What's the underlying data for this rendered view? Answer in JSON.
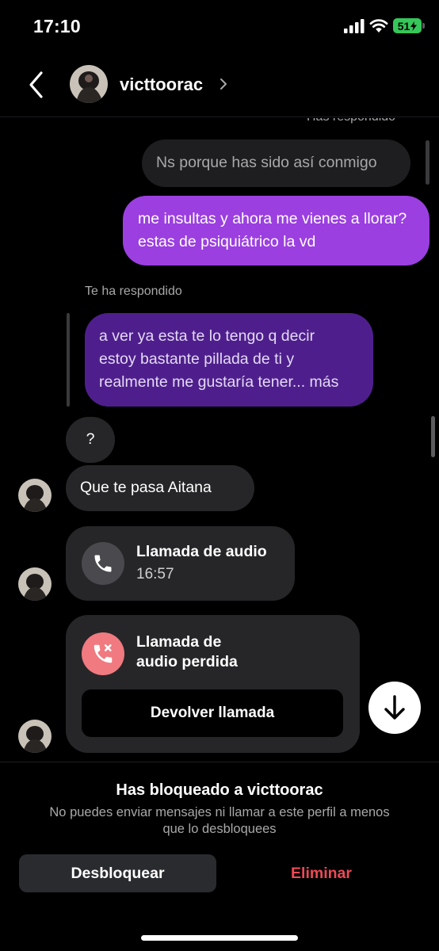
{
  "status_bar": {
    "time": "17:10",
    "battery": "51"
  },
  "header": {
    "username": "victtoorac"
  },
  "messages": {
    "reply_label_top": "Has respondido",
    "quoted_message": "Ns porque has sido así conmigo",
    "sent_message": "me insultas y ahora me vienes a llorar? estas de psiquiátrico la vd",
    "reply_label_received": "Te ha respondido",
    "quoted_received_line1": "a ver ya esta te lo tengo q decir",
    "quoted_received_line2": "estoy bastante pillada de ti y",
    "quoted_received_line3": "realmente me gustaría tener... más",
    "received_question": "?",
    "received_message": "Que te pasa Aitana"
  },
  "calls": {
    "audio_call_title": "Llamada de audio",
    "audio_call_time": "16:57",
    "missed_call_title_line1": "Llamada de",
    "missed_call_title_line2": "audio perdida",
    "callback_label": "Devolver llamada"
  },
  "footer": {
    "blocked_title": "Has bloqueado a victtoorac",
    "blocked_desc_line1": "No puedes enviar mensajes ni llamar a este perfil a menos",
    "blocked_desc_line2": "que lo desbloquees",
    "unblock_label": "Desbloquear",
    "delete_label": "Eliminar"
  },
  "colors": {
    "sent_bubble": "#9b3fe0",
    "quoted_received_bubble": "#4e1f8c",
    "missed_call_icon_bg": "#f07a80",
    "delete_text": "#ed4956",
    "battery": "#35c759"
  },
  "icons": [
    "signal-icon",
    "wifi-icon",
    "back-icon",
    "chevron-right-icon",
    "phone-icon",
    "missed-call-icon",
    "arrow-down-icon"
  ]
}
